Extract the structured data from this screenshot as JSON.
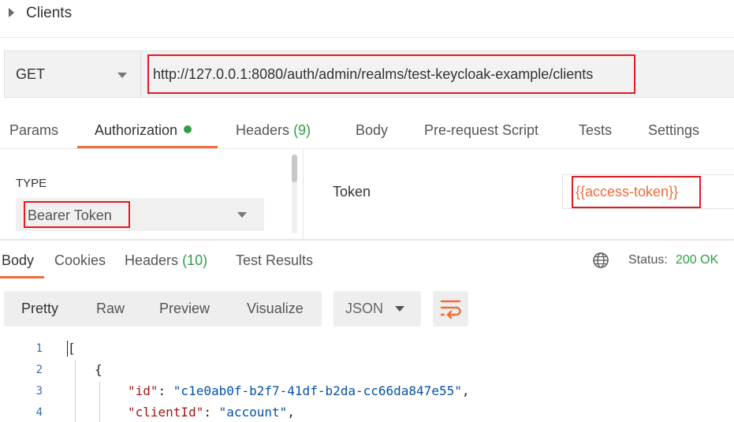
{
  "header": {
    "title": "Clients"
  },
  "request": {
    "method": "GET",
    "url": "http://127.0.0.1:8080/auth/admin/realms/test-keycloak-example/clients"
  },
  "request_tabs": {
    "params": "Params",
    "authorization": "Authorization",
    "headers": "Headers",
    "headers_count": "(9)",
    "body": "Body",
    "prerequest": "Pre-request Script",
    "tests": "Tests",
    "settings": "Settings"
  },
  "auth": {
    "type_label": "TYPE",
    "type_value": "Bearer Token",
    "token_label": "Token",
    "token_value": "{{access-token}}"
  },
  "response_tabs": {
    "body": "Body",
    "cookies": "Cookies",
    "headers": "Headers",
    "headers_count": "(10)",
    "test_results": "Test Results"
  },
  "status": {
    "label": "Status:",
    "value": "200 OK"
  },
  "view": {
    "pretty": "Pretty",
    "raw": "Raw",
    "preview": "Preview",
    "visualize": "Visualize",
    "format": "JSON"
  },
  "code": {
    "line_numbers": [
      "1",
      "2",
      "3",
      "4"
    ],
    "line1": "[",
    "line2": "{",
    "line3_key": "\"id\"",
    "line3_sep": ": ",
    "line3_value": "\"c1e0ab0f-b2f7-41df-b2da-cc66da847e55\"",
    "line3_end": ",",
    "line4_key": "\"clientId\"",
    "line4_sep": ": ",
    "line4_value": "\"account\"",
    "line4_end": ","
  },
  "colors": {
    "accent": "#f26b3a",
    "success": "#2f9e44",
    "highlight": "#e01b24"
  },
  "icons": [
    "caret-right-icon",
    "chevron-down-icon",
    "globe-icon",
    "wrap-lines-icon"
  ]
}
